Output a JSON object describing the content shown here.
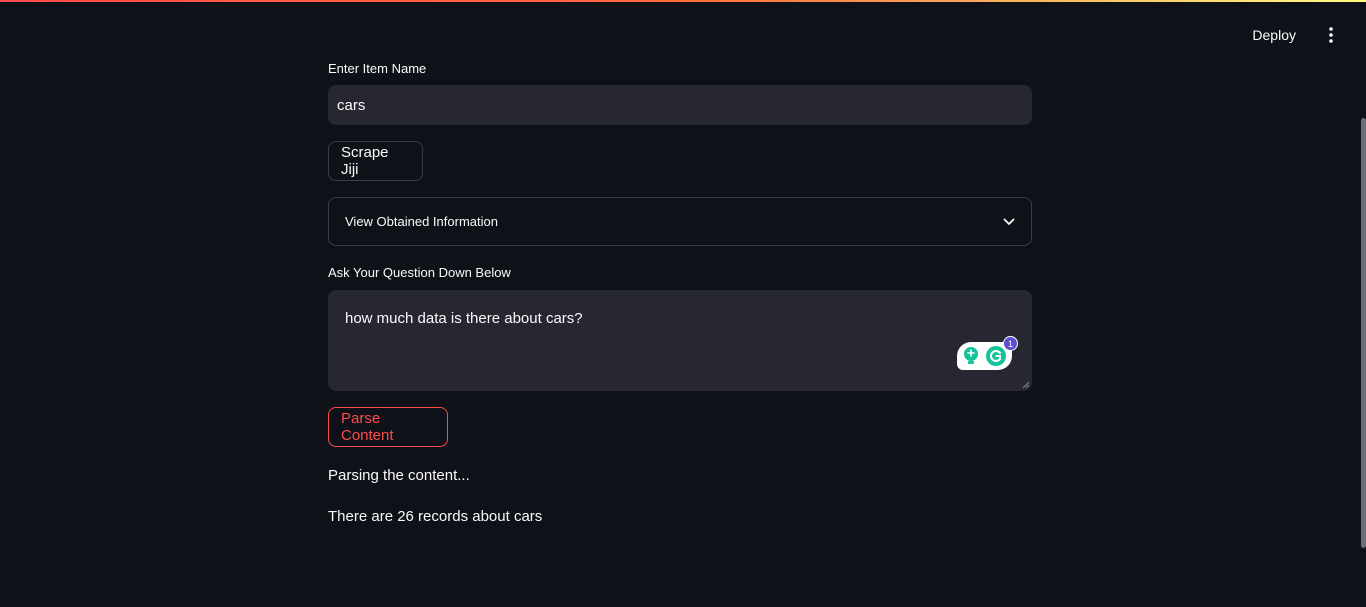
{
  "header": {
    "deploy_label": "Deploy",
    "menu_icon": "vertical-dots-icon"
  },
  "form": {
    "item_name_label": "Enter Item Name",
    "item_name_value": "cars",
    "scrape_button_label": "Scrape Jiji",
    "expander_label": "View Obtained Information",
    "question_label": "Ask Your Question Down Below",
    "question_value": "how much data is there about cars?",
    "grammarly_count": "1",
    "parse_button_label": "Parse Content"
  },
  "output": {
    "status_message": "Parsing the content...",
    "result_message": "There are 26 records about cars"
  },
  "colors": {
    "background": "#0e1117",
    "input_background": "#262730",
    "accent": "#ff4b4b",
    "grammarly_green": "#15c39a"
  }
}
